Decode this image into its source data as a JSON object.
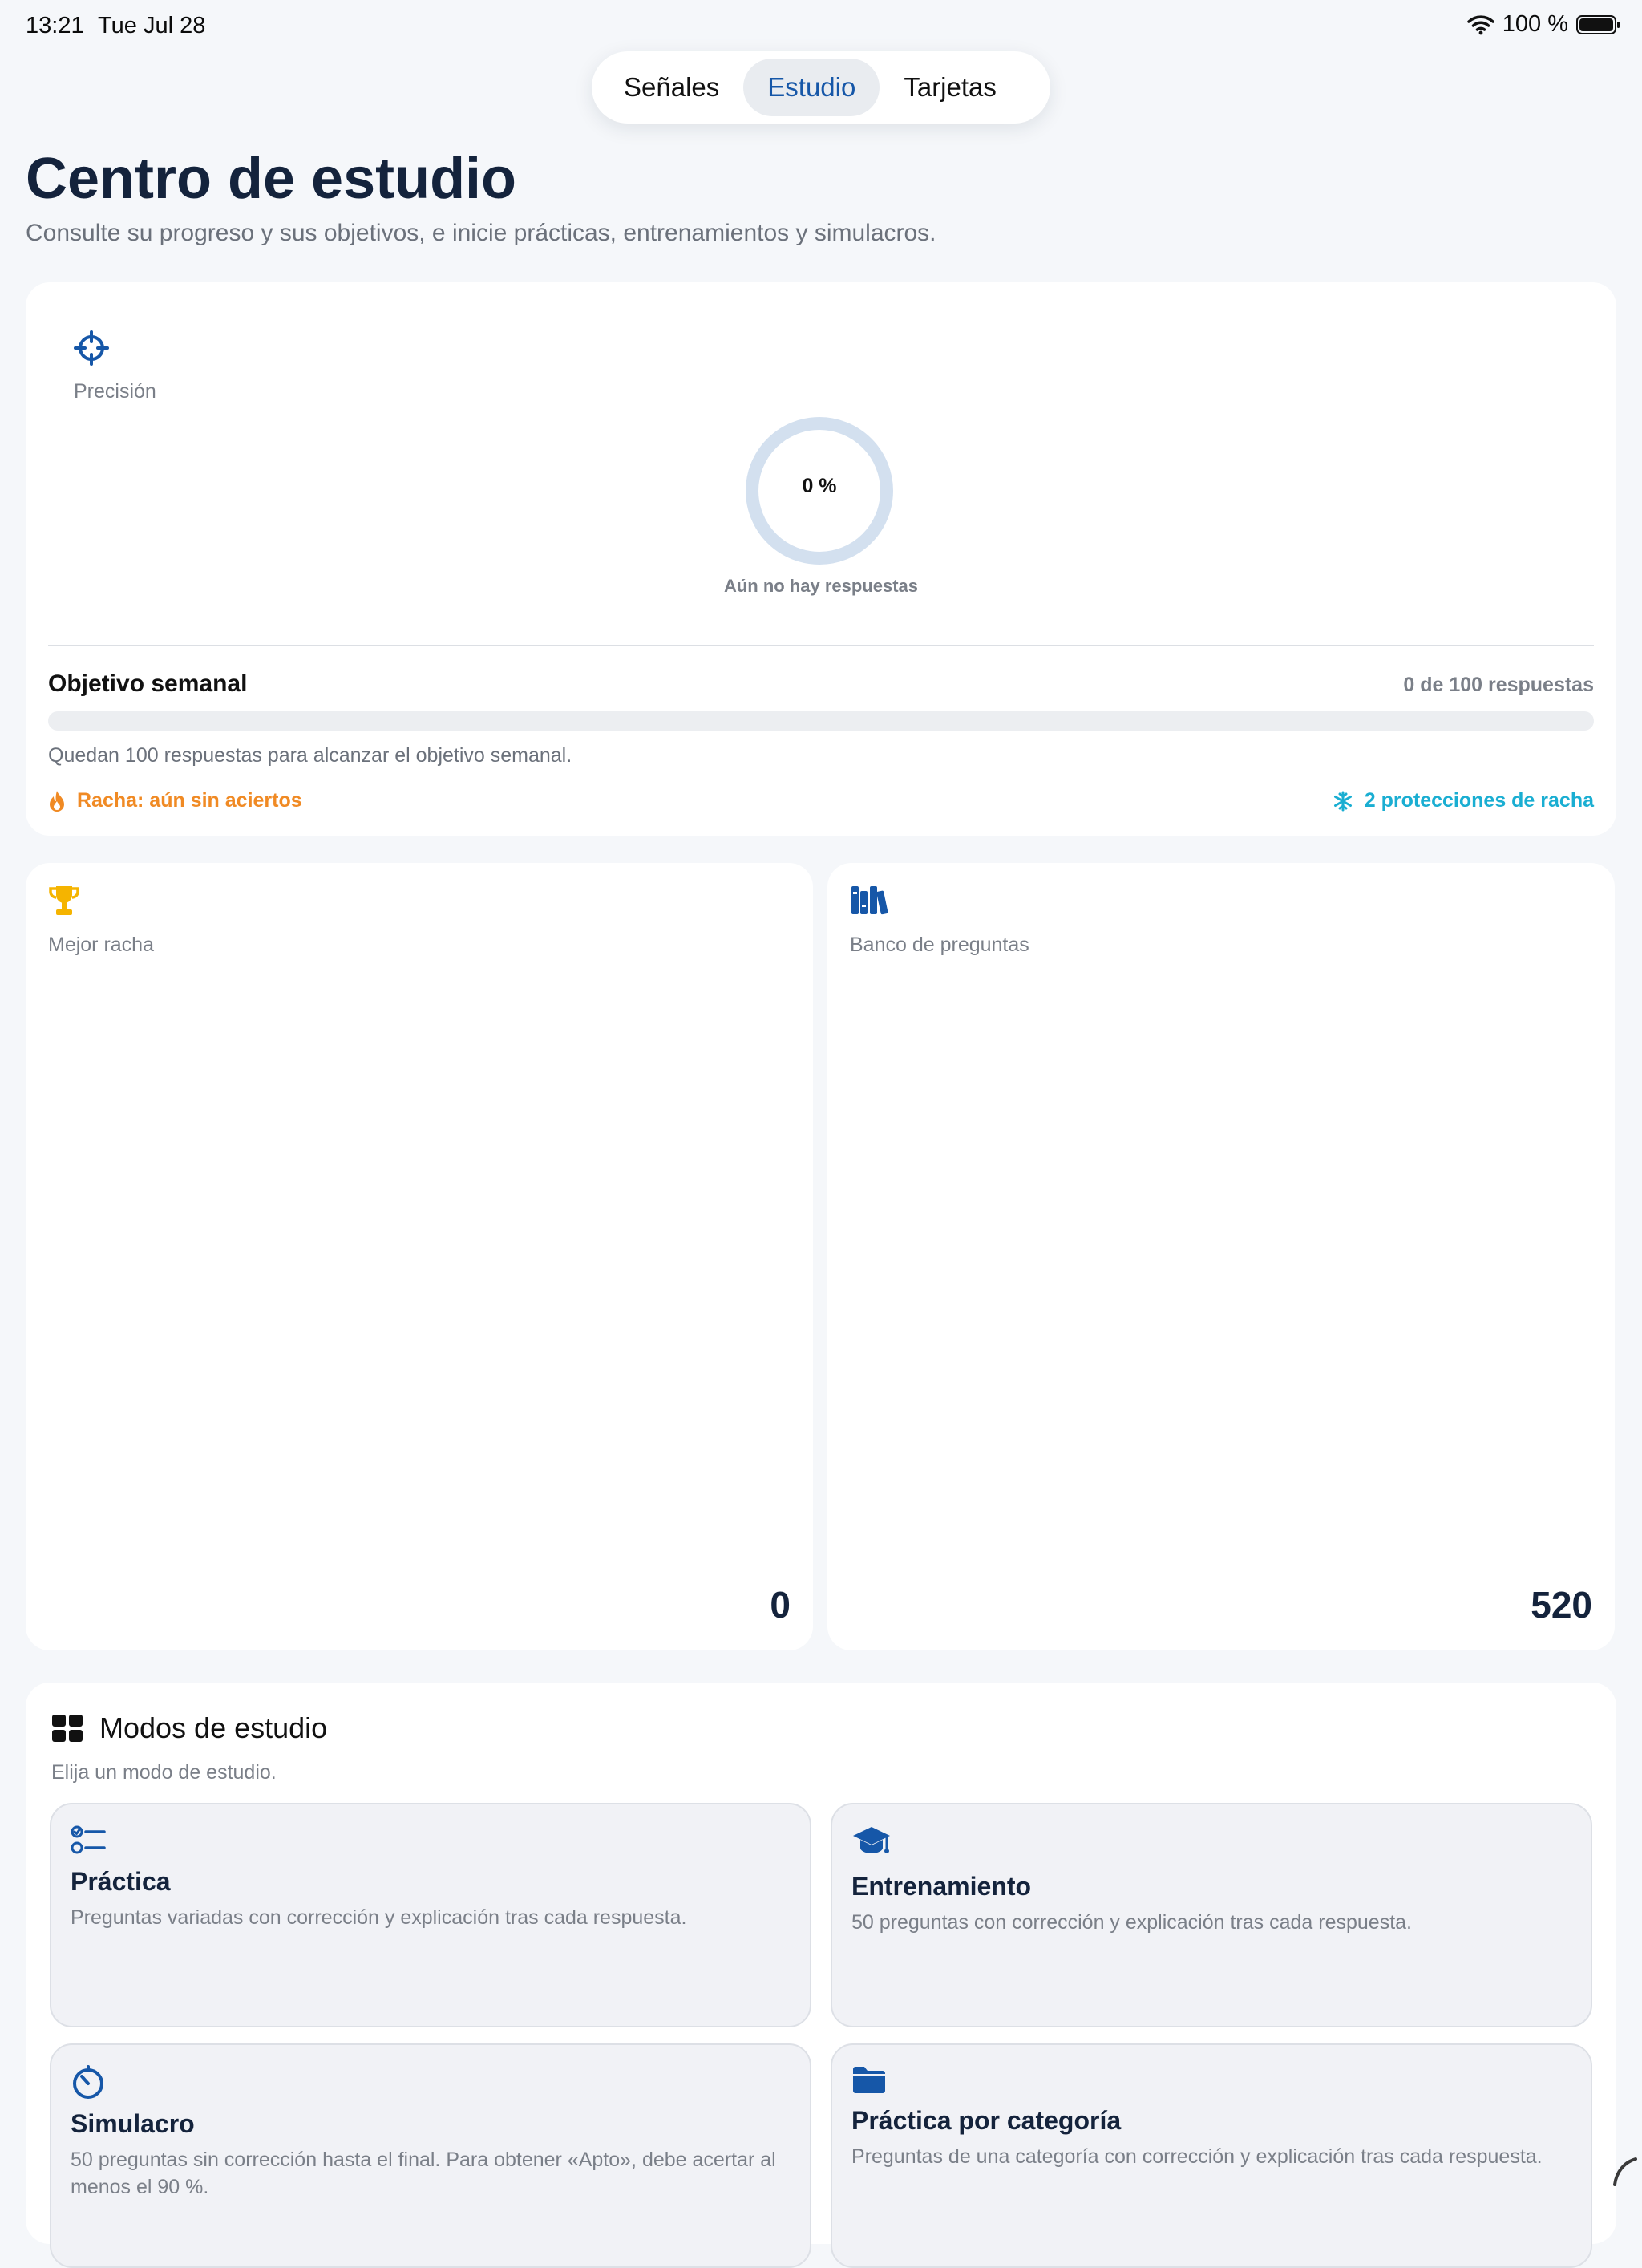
{
  "status_bar": {
    "time": "13:21",
    "date": "Tue Jul 28",
    "battery": "100 %"
  },
  "tabs": [
    {
      "label": "Señales",
      "active": false
    },
    {
      "label": "Estudio",
      "active": true
    },
    {
      "label": "Tarjetas",
      "active": false
    }
  ],
  "header": {
    "title": "Centro de estudio",
    "subtitle": "Consulte su progreso y sus objetivos, e inicie prácticas, entrenamientos y simulacros."
  },
  "precision": {
    "label": "Precisión",
    "value": "0 %",
    "value_fraction": 0,
    "caption": "Aún no hay respuestas"
  },
  "weekly_goal": {
    "title": "Objetivo semanal",
    "count": "0 de 100 respuestas",
    "progress_fraction": 0,
    "hint": "Quedan 100 respuestas para alcanzar el objetivo semanal.",
    "streak": "Racha: aún sin aciertos",
    "freezes": "2 protecciones de racha"
  },
  "stats": {
    "best_streak": {
      "label": "Mejor racha",
      "value": "0"
    },
    "question_bank": {
      "label": "Banco de preguntas",
      "value": "520"
    }
  },
  "modes": {
    "title": "Modos de estudio",
    "hint": "Elija un modo de estudio.",
    "items": [
      {
        "title": "Práctica",
        "desc": "Preguntas variadas con corrección y explicación tras cada respuesta.",
        "icon": "checklist-icon"
      },
      {
        "title": "Entrenamiento",
        "desc": "50 preguntas con corrección y explicación tras cada respuesta.",
        "icon": "graduation-cap-icon"
      },
      {
        "title": "Simulacro",
        "desc": "50 preguntas sin corrección hasta el final. Para obtener «Apto», debe acertar al menos el 90 %.",
        "icon": "timer-icon"
      },
      {
        "title": "Práctica por categoría",
        "desc": "Preguntas de una categoría con corrección y explicación tras cada respuesta.",
        "icon": "folder-icon"
      }
    ]
  },
  "colors": {
    "accent": "#1657a8",
    "title": "#14233c",
    "streak": "#f08a24",
    "freeze": "#1aaed2",
    "trophy": "#f5b400",
    "ring_track": "#d3e0ef"
  }
}
